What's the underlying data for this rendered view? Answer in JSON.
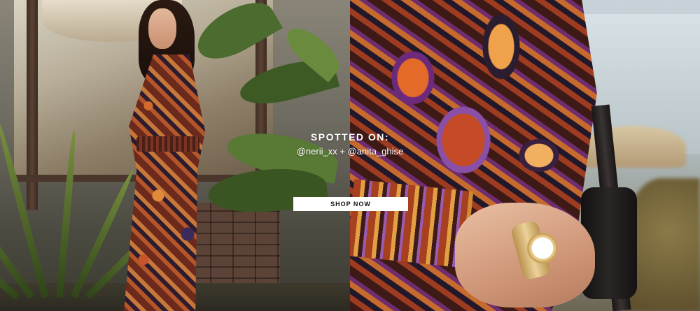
{
  "hero": {
    "left_image": "woman-in-paisley-dress-photo",
    "right_image": "paisley-sleeve-and-watch-closeup-photo",
    "spotted_title": "SPOTTED ON:",
    "spotted_handles": "@nerii_xx + @anita_ghise",
    "cta_label": "SHOP NOW"
  },
  "colors": {
    "text": "#ffffff",
    "button_bg": "#ffffff",
    "button_text": "#111111"
  }
}
